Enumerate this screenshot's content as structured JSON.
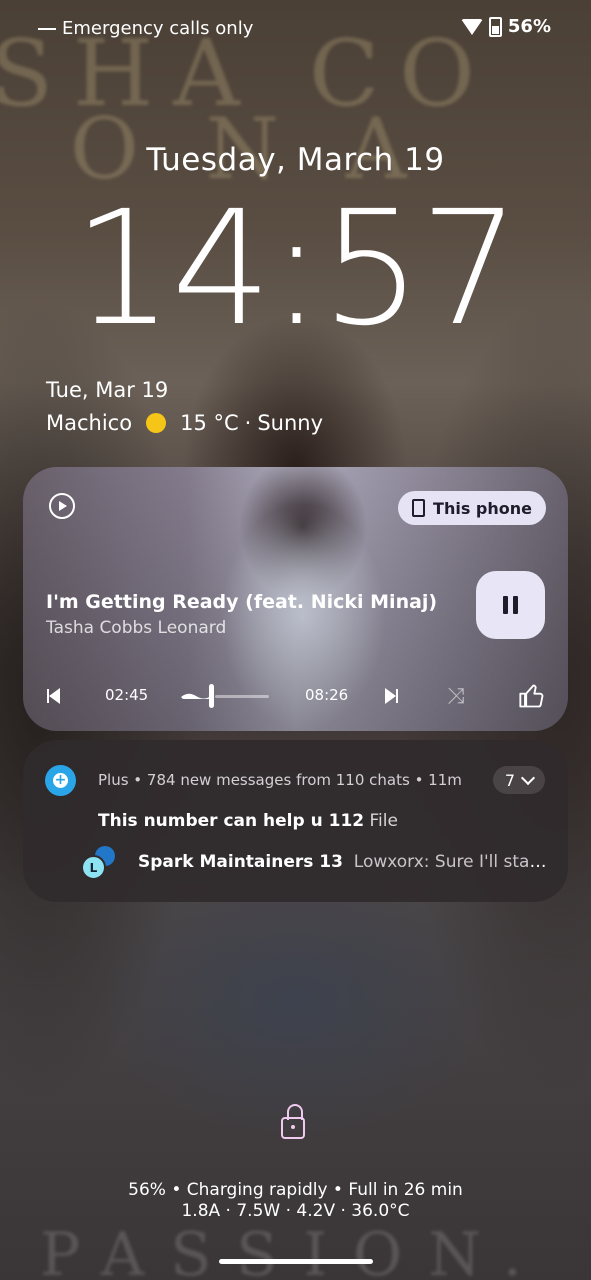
{
  "status_bar": {
    "carrier": "Emergency calls only",
    "battery_percent": "56%",
    "icons": [
      "wifi-icon",
      "battery-charging-icon"
    ]
  },
  "lockscreen": {
    "date": "Tuesday,  March  19",
    "time": "14:57"
  },
  "weather": {
    "date": "Tue, Mar 19",
    "location": "Machico",
    "temperature": "15 °C",
    "separator": "·",
    "condition": "Sunny",
    "icon": "sun-icon"
  },
  "media": {
    "output_device": "This phone",
    "title": "I'm Getting Ready (feat. Nicki Minaj)",
    "artist": "Tasha Cobbs Leonard",
    "elapsed": "02:45",
    "duration": "08:26",
    "progress_fraction": 0.33,
    "playing": true
  },
  "notification": {
    "header": "Plus • 784 new messages from 110 chats • 11m",
    "count": "7",
    "line1_bold": "This number can help u 112",
    "line1_text": "File",
    "line2_bold": "Spark Maintainers 13",
    "line2_text": "Lowxorx: Sure I'll stay...",
    "avatar_letter": "L",
    "accent_color": "#2aa5e8"
  },
  "charging": {
    "line1": "56% • Charging rapidly • Full in 26 min",
    "line2": "1.8A · 7.5W · 4.2V · 36.0°C"
  }
}
